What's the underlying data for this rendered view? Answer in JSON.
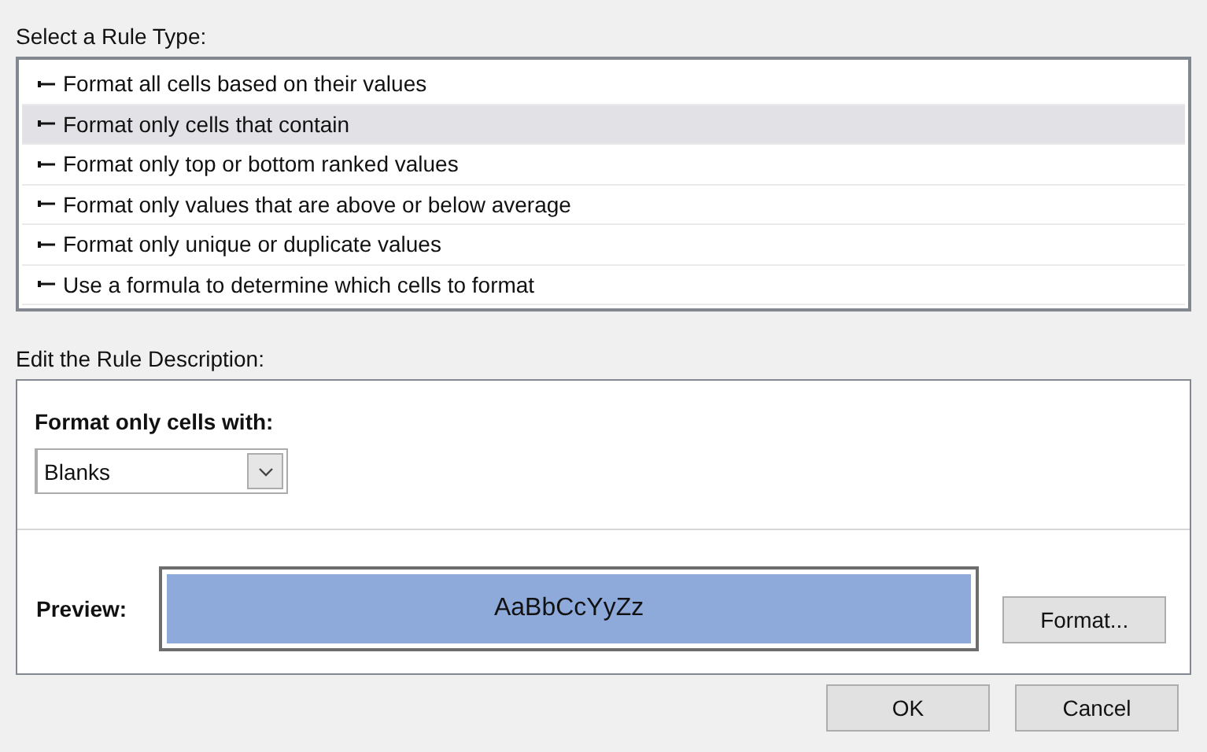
{
  "rule_type": {
    "heading": "Select a Rule Type:",
    "items": [
      {
        "label": "Format all cells based on their values",
        "selected": false
      },
      {
        "label": "Format only cells that contain",
        "selected": true
      },
      {
        "label": "Format only top or bottom ranked values",
        "selected": false
      },
      {
        "label": "Format only values that are above or below average",
        "selected": false
      },
      {
        "label": "Format only unique or duplicate values",
        "selected": false
      },
      {
        "label": "Use a formula to determine which cells to format",
        "selected": false
      }
    ]
  },
  "description": {
    "heading": "Edit the Rule Description:",
    "condition_label": "Format only cells with:",
    "condition_value": "Blanks",
    "preview_label": "Preview:",
    "preview_text": "AaBbCcYyZz",
    "format_button": "Format..."
  },
  "buttons": [
    "OK",
    "Cancel"
  ]
}
